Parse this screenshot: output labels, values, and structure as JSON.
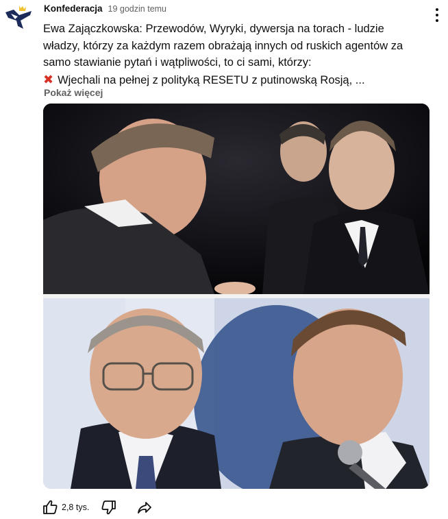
{
  "post": {
    "channel": "Konfederacja",
    "time": "19 godzin temu",
    "text_lines": [
      "Ewa Zajączkowska: Przewodów, Wyryki, dywersja na torach - ludzie",
      "władzy, którzy za każdym razem obrażają innych od ruskich agentów za",
      "samo stawianie pytań i wątpliwości, to ci sami, którzy:",
      "Wjechali na pełnej z polityką RESETU z putinowską Rosją, ..."
    ],
    "show_more": "Pokaż więcej"
  },
  "actions": {
    "like_count": "2,8 tys."
  },
  "icons": {
    "avatar": "konfederacja-crown-logo",
    "menu": "more-vert-icon",
    "bullet": "cross-mark-icon",
    "like": "thumb-up-icon",
    "dislike": "thumb-down-icon",
    "share": "share-arrow-icon"
  },
  "colors": {
    "logo_navy": "#1c2b5a",
    "logo_gold": "#f2c230",
    "cross_red": "#d93025",
    "secondary_text": "#606060"
  }
}
